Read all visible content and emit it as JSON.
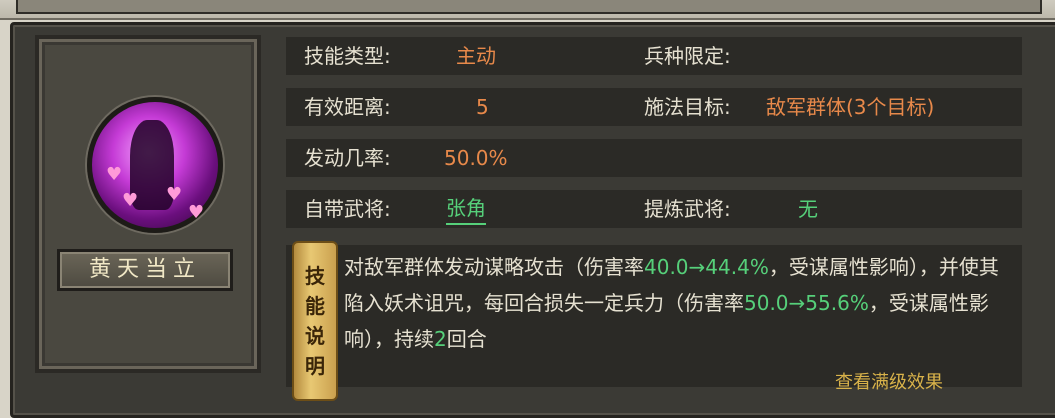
{
  "skill": {
    "name": "黄天当立",
    "icon": "purple-hearts-sorcerer-icon",
    "type_label": "技能类型:",
    "type_value": "主动",
    "troop_label": "兵种限定:",
    "troop_value": "",
    "range_label": "有效距离:",
    "range_value": "5",
    "target_label": "施法目标:",
    "target_value": "敌军群体(3个目标)",
    "rate_label": "发动几率:",
    "rate_value": "50.0%",
    "general_label": "自带武将:",
    "general_value": "张角",
    "refine_label": "提炼武将:",
    "refine_value": "无",
    "desc_title_chars": [
      "技",
      "能",
      "说",
      "明"
    ],
    "desc": {
      "p1": "对敌军群体发动谋略攻击（伤害率",
      "h1": "40.0→44.4%",
      "p2": "，受谋属性影响），并使其陷入妖术诅咒，每回合损失一定兵力（伤害率",
      "h2": "50.0→55.6%",
      "p3": "，受谋属性影响），持续",
      "h3": "2",
      "p4": "回合"
    },
    "bottom_link": "查看满级效果"
  },
  "colors": {
    "panel": "#3b3a35",
    "row": "#2b2a26",
    "orange": "#e8894a",
    "green": "#56d07a"
  }
}
